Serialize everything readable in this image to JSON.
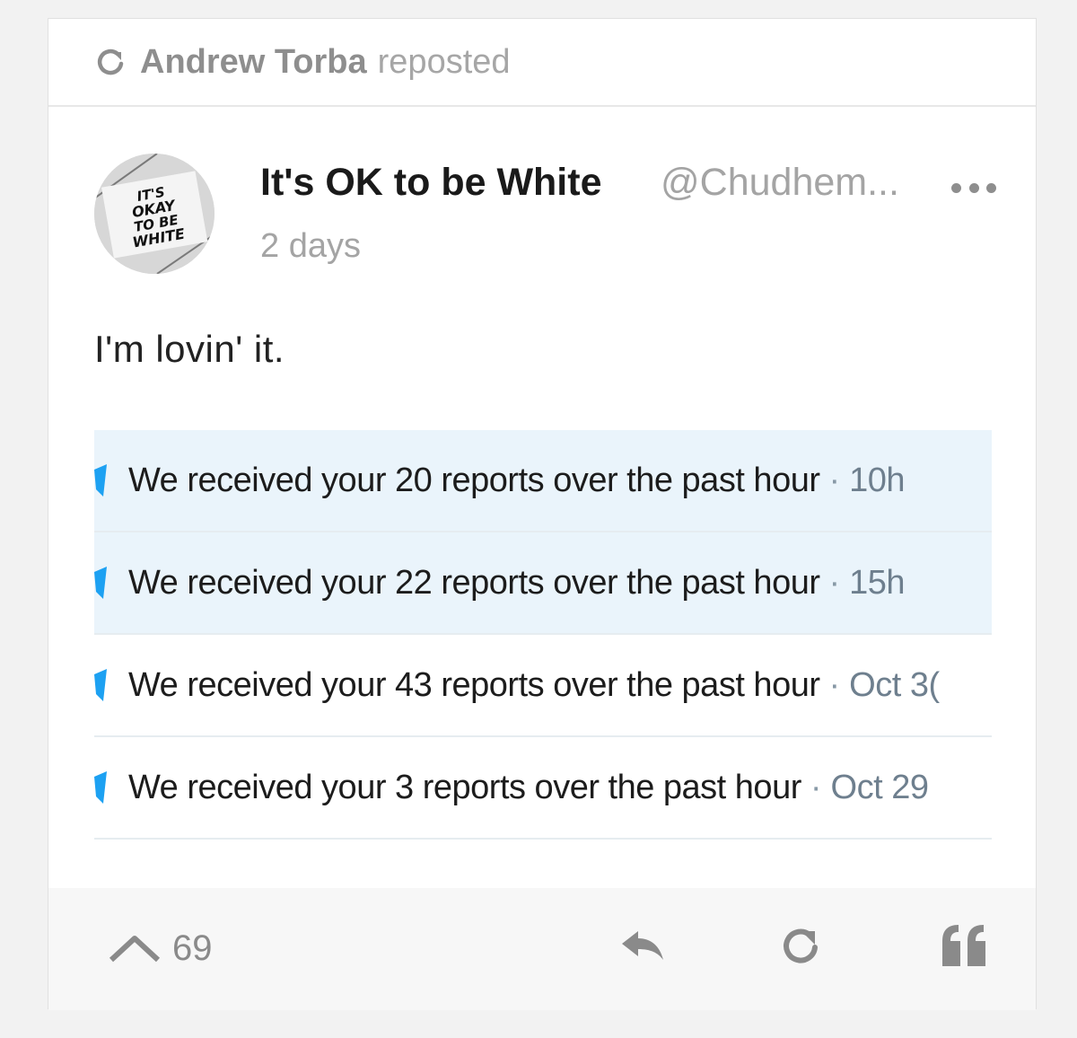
{
  "repost": {
    "user": "Andrew Torba",
    "action": "reposted",
    "icon": "repost-icon"
  },
  "post": {
    "display_name": "It's OK to be White",
    "handle": "@Chudhem...",
    "time": "2 days",
    "text": "I'm lovin' it.",
    "avatar_text": [
      "IT'S",
      "OKAY",
      "TO BE",
      "WHITE"
    ],
    "more_icon": "more-dots-icon"
  },
  "notifications": [
    {
      "message": "We received your 20 reports over the past hour",
      "separator": "·",
      "time": "10h",
      "unread": true
    },
    {
      "message": "We received your 22 reports over the past hour",
      "separator": "·",
      "time": "15h",
      "unread": true
    },
    {
      "message": "We received your 43 reports over the past hour",
      "separator": "·",
      "time": "Oct 3(",
      "unread": false
    },
    {
      "message": "We received your 3 reports over the past hour",
      "separator": "·",
      "time": "Oct 29",
      "unread": false
    }
  ],
  "footer": {
    "score": "69",
    "upvote_icon": "upvote-chevron-icon",
    "reply_icon": "reply-icon",
    "repost_icon": "repost-icon",
    "quote_icon": "quote-icon"
  },
  "colors": {
    "unread_bg": "#eaf4fb",
    "bird_blue": "#1da1f2",
    "muted_text": "#a4a4a4"
  }
}
